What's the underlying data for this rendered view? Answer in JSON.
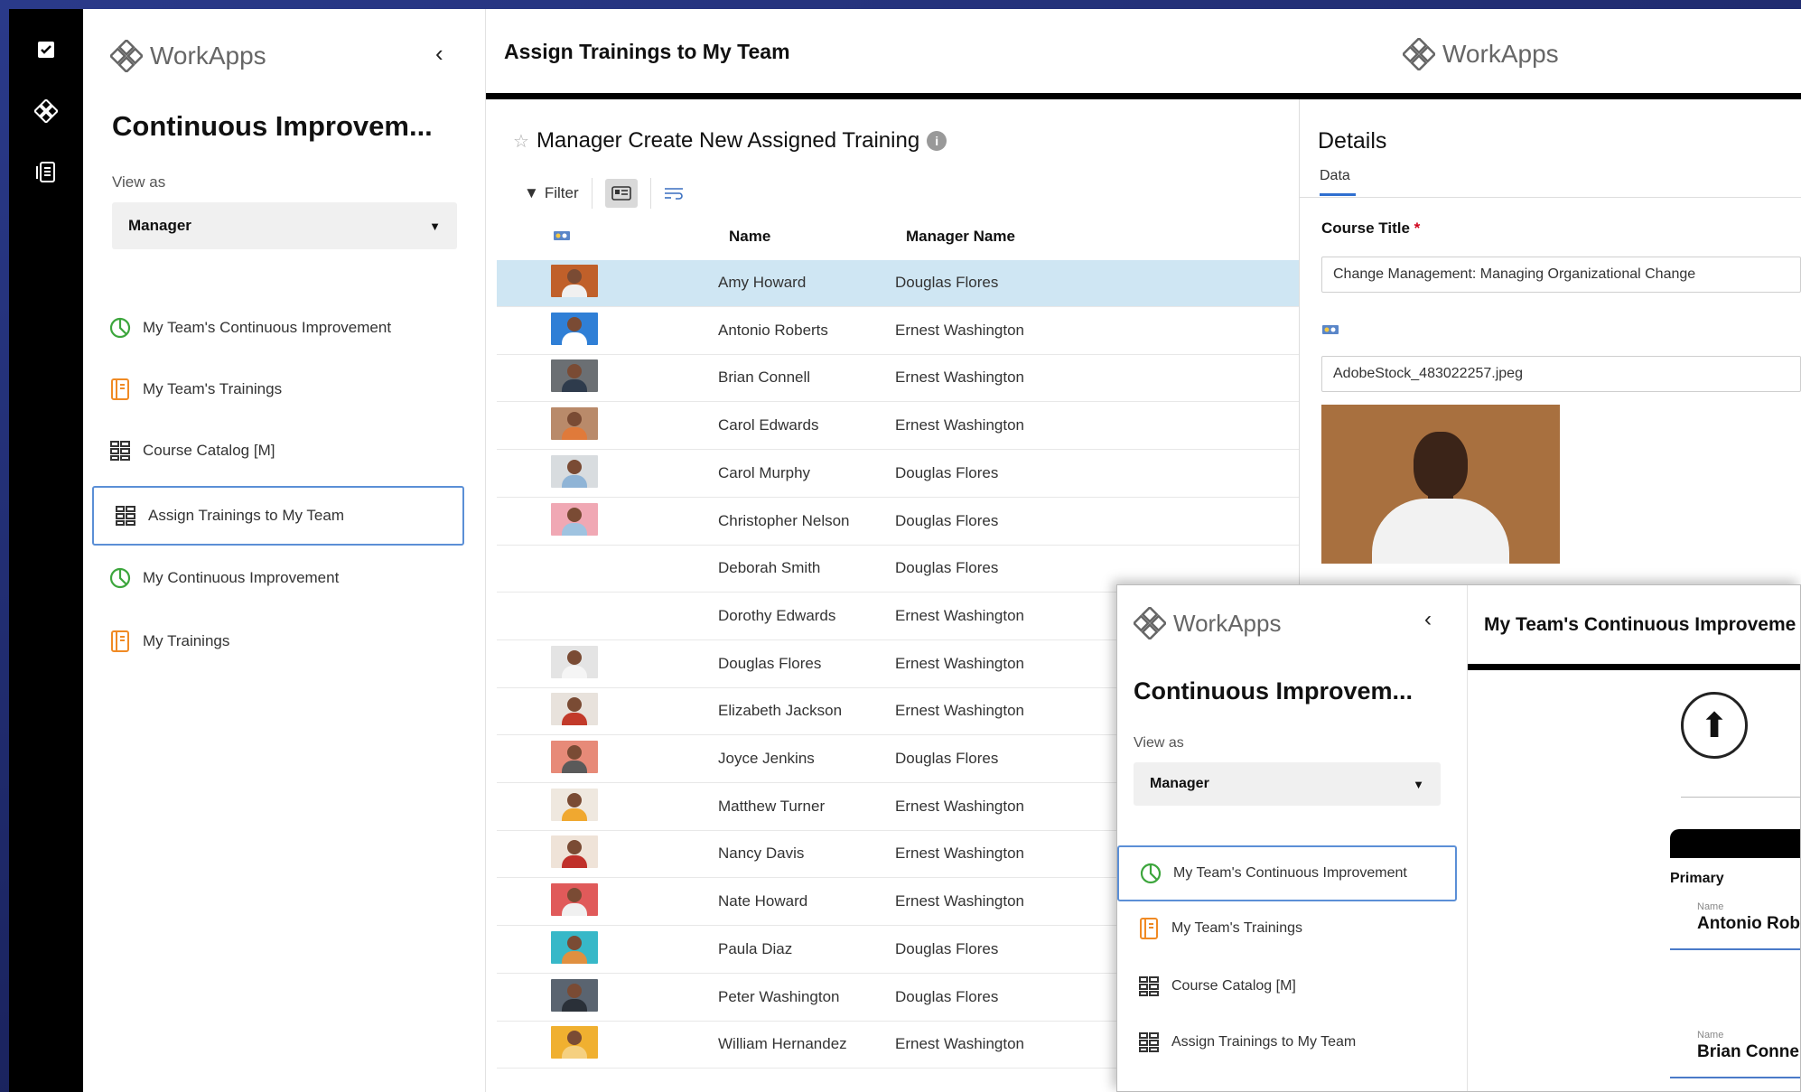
{
  "brand": "WorkApps",
  "app_title": "Continuous Improvem...",
  "view_as_label": "View as",
  "view_as_value": "Manager",
  "nav_items": [
    {
      "label": "My Team's Continuous Improvement",
      "icon": "pie-chart-icon"
    },
    {
      "label": "My Team's Trainings",
      "icon": "notebook-icon"
    },
    {
      "label": "Course Catalog [M]",
      "icon": "grid-list-icon"
    },
    {
      "label": "Assign Trainings to My Team",
      "icon": "grid-list-icon"
    },
    {
      "label": "My Continuous Improvement",
      "icon": "pie-chart-icon"
    },
    {
      "label": "My Trainings",
      "icon": "notebook-icon"
    }
  ],
  "selected_nav": "Assign Trainings to My Team",
  "page_title": "Assign Trainings to My Team",
  "header_brand": "WorkApps",
  "list": {
    "title": "Manager Create New Assigned Training",
    "filter_label": "Filter",
    "columns": [
      "Name",
      "Manager Name"
    ],
    "rows": [
      {
        "name": "Amy Howard",
        "manager": "Douglas Flores",
        "photo": true,
        "color": "#c0602a",
        "shirt": "#f0f0f0"
      },
      {
        "name": "Antonio Roberts",
        "manager": "Ernest Washington",
        "photo": true,
        "color": "#2f7fd6",
        "shirt": "#ffffff"
      },
      {
        "name": "Brian Connell",
        "manager": "Ernest Washington",
        "photo": true,
        "color": "#6b6f73",
        "shirt": "#2e3b4c"
      },
      {
        "name": "Carol Edwards",
        "manager": "Ernest Washington",
        "photo": true,
        "color": "#b98a6a",
        "shirt": "#e07a3a"
      },
      {
        "name": "Carol Murphy",
        "manager": "Douglas Flores",
        "photo": true,
        "color": "#d8dcdf",
        "shirt": "#8fb4d6"
      },
      {
        "name": "Christopher Nelson",
        "manager": "Douglas Flores",
        "photo": true,
        "color": "#f0a8b4",
        "shirt": "#9fc3e0"
      },
      {
        "name": "Deborah Smith",
        "manager": "Douglas Flores",
        "photo": false
      },
      {
        "name": "Dorothy Edwards",
        "manager": "Ernest Washington",
        "photo": false
      },
      {
        "name": "Douglas Flores",
        "manager": "Ernest Washington",
        "photo": true,
        "color": "#e4e4e4",
        "shirt": "#f5f5f5"
      },
      {
        "name": "Elizabeth Jackson",
        "manager": "Ernest Washington",
        "photo": true,
        "color": "#e8e2dc",
        "shirt": "#c23a2a"
      },
      {
        "name": "Joyce Jenkins",
        "manager": "Douglas Flores",
        "photo": true,
        "color": "#e78a78",
        "shirt": "#5a5a5a"
      },
      {
        "name": "Matthew Turner",
        "manager": "Ernest Washington",
        "photo": true,
        "color": "#efe8df",
        "shirt": "#f0a830"
      },
      {
        "name": "Nancy Davis",
        "manager": "Ernest Washington",
        "photo": true,
        "color": "#efe3d8",
        "shirt": "#c0302a"
      },
      {
        "name": "Nate Howard",
        "manager": "Ernest Washington",
        "photo": true,
        "color": "#e05a5a",
        "shirt": "#f0f0f0"
      },
      {
        "name": "Paula Diaz",
        "manager": "Douglas Flores",
        "photo": true,
        "color": "#37b8c8",
        "shirt": "#e09040"
      },
      {
        "name": "Peter Washington",
        "manager": "Douglas Flores",
        "photo": true,
        "color": "#5a6470",
        "shirt": "#2a3038"
      },
      {
        "name": "William Hernandez",
        "manager": "Ernest Washington",
        "photo": true,
        "color": "#f0b030",
        "shirt": "#f5d080"
      }
    ]
  },
  "details": {
    "title": "Details",
    "tab": "Data",
    "course_title_label": "Course Title",
    "course_title_value": "Change Management: Managing Organizational Change",
    "image_file": "AdobeStock_483022257.jpeg"
  },
  "overlay": {
    "brand": "WorkApps",
    "app_title": "Continuous Improvem...",
    "view_as_label": "View as",
    "view_as_value": "Manager",
    "nav_items": [
      {
        "label": "My Team's Continuous Improvement",
        "icon": "pie-chart-icon"
      },
      {
        "label": "My Team's Trainings",
        "icon": "notebook-icon"
      },
      {
        "label": "Course Catalog [M]",
        "icon": "grid-list-icon"
      },
      {
        "label": "Assign Trainings to My Team",
        "icon": "grid-list-icon"
      }
    ],
    "page_title": "My Team's Continuous Improveme",
    "primary_label": "Primary",
    "name_label": "Name",
    "person_1": "Antonio Rob",
    "person_2": "Brian Conne"
  },
  "colors": {
    "rail": "#000000",
    "selected_row": "#cfe6f3",
    "selected_nav_border": "#5b8fd6",
    "accent_green": "#3da63d",
    "accent_orange": "#f08a24"
  }
}
